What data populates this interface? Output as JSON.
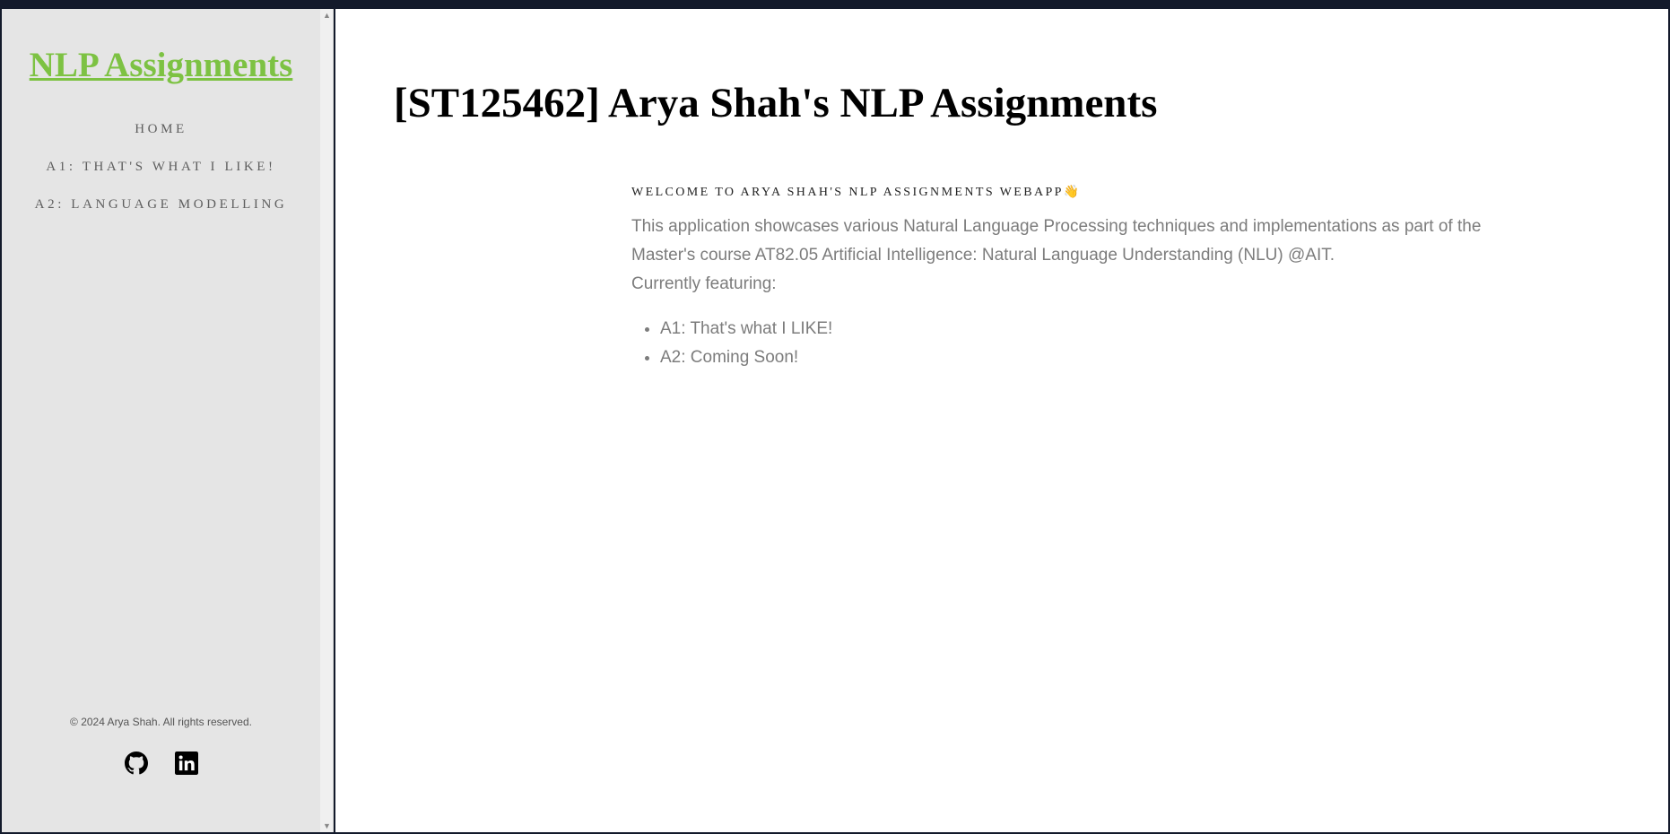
{
  "sidebar": {
    "logo": "NLP Assignments",
    "nav": [
      {
        "label": "HOME"
      },
      {
        "label": "A1: THAT'S WHAT I LIKE!"
      },
      {
        "label": "A2: LANGUAGE MODELLING"
      }
    ],
    "copyright": "© 2024 Arya Shah. All rights reserved.",
    "social": [
      {
        "icon": "github-icon"
      },
      {
        "icon": "linkedin-icon"
      }
    ]
  },
  "main": {
    "title": "[ST125462] Arya Shah's NLP Assignments",
    "welcome": "WELCOME TO ARYA SHAH'S NLP ASSIGNMENTS WEBAPP",
    "welcome_emoji": "👋",
    "description_line1": "This application showcases various Natural Language Processing techniques and implementations as part of the Master's course AT82.05 Artificial Intelligence: Natural Language Understanding (NLU) @AIT.",
    "description_line2": "Currently featuring:",
    "features": [
      "A1: That's what I LIKE!",
      "A2: Coming Soon!"
    ]
  },
  "colors": {
    "accent": "#7dc243",
    "sidebar_bg": "#e5e5e5",
    "page_frame": "#131a2b",
    "body_text": "#7c7c7c"
  }
}
